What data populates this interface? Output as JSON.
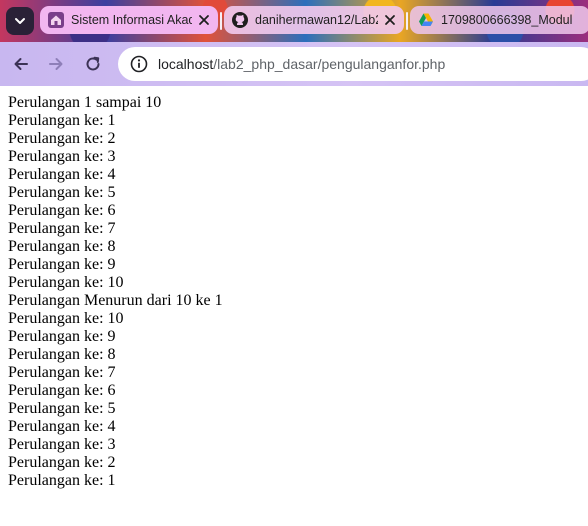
{
  "browser": {
    "tabs": [
      {
        "title": "Sistem Informasi Akademik",
        "favicon": "home-icon"
      },
      {
        "title": "danihermawan12/Lab2_php_dasar",
        "favicon": "github-icon"
      },
      {
        "title": "1709800666398_Modul",
        "favicon": "drive-icon"
      }
    ],
    "url_host": "localhost",
    "url_path": "/lab2_php_dasar/pengulanganfor.php"
  },
  "page": {
    "lines": [
      "Perulangan 1 sampai 10",
      "Perulangan ke: 1",
      "Perulangan ke: 2",
      "Perulangan ke: 3",
      "Perulangan ke: 4",
      "Perulangan ke: 5",
      "Perulangan ke: 6",
      "Perulangan ke: 7",
      "Perulangan ke: 8",
      "Perulangan ke: 9",
      "Perulangan ke: 10",
      "Perulangan Menurun dari 10 ke 1",
      "Perulangan ke: 10",
      "Perulangan ke: 9",
      "Perulangan ke: 8",
      "Perulangan ke: 7",
      "Perulangan ke: 6",
      "Perulangan ke: 5",
      "Perulangan ke: 4",
      "Perulangan ke: 3",
      "Perulangan ke: 2",
      "Perulangan ke: 1"
    ]
  }
}
